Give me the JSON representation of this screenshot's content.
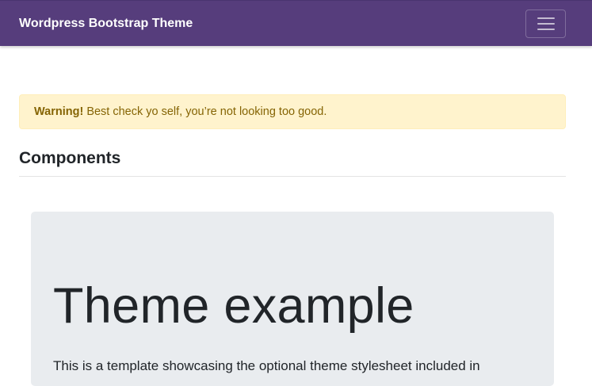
{
  "navbar": {
    "brand": "Wordpress Bootstrap Theme",
    "toggler_icon": "hamburger-menu-icon",
    "background_color": "#563d7c"
  },
  "alert": {
    "strong": "Warning!",
    "message": " Best check yo self, you’re not looking too good.",
    "background_color": "#fff3cd",
    "text_color": "#856404"
  },
  "section": {
    "title": "Components"
  },
  "jumbotron": {
    "title": "Theme example",
    "lead": "This is a template showcasing the optional theme stylesheet included in",
    "background_color": "#e9ecef"
  }
}
